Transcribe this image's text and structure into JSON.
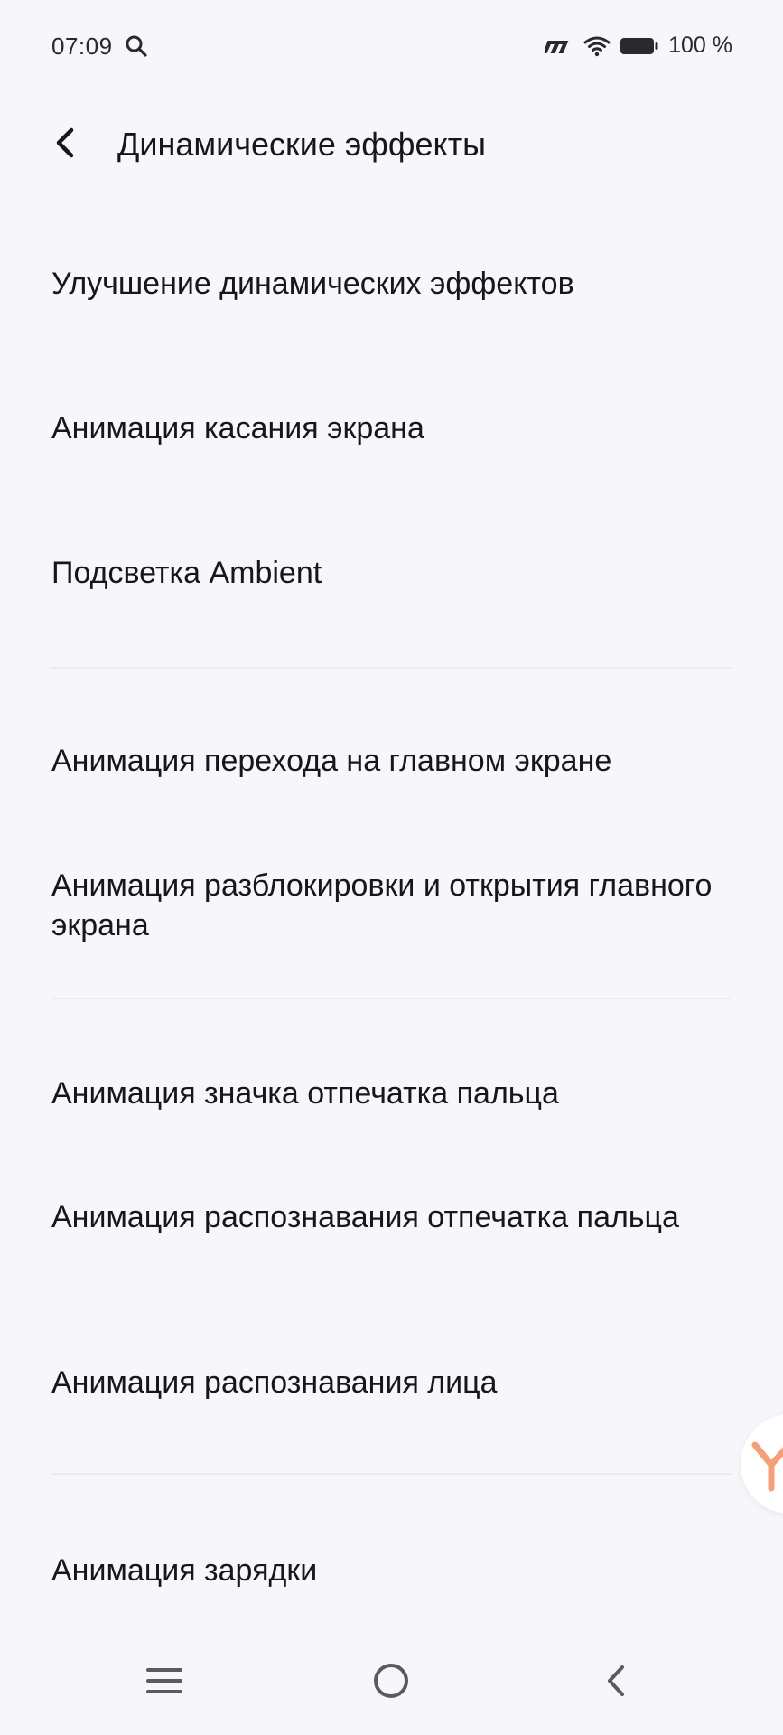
{
  "status_bar": {
    "time": "07:09",
    "battery_text": "100 %"
  },
  "header": {
    "title": "Динамические эффекты"
  },
  "items": [
    {
      "label": "Улучшение динамических эффектов"
    },
    {
      "label": "Анимация касания экрана"
    },
    {
      "label": "Подсветка Ambient"
    },
    {
      "label": "Анимация перехода на главном экране"
    },
    {
      "label": "Анимация разблокировки и открытия главного экрана"
    },
    {
      "label": "Анимация значка отпечатка пальца"
    },
    {
      "label": "Анимация распознавания отпечатка пальца"
    },
    {
      "label": "Анимация распознавания лица"
    },
    {
      "label": "Анимация зарядки"
    }
  ],
  "icons": {
    "status_search": "search-icon",
    "status_network": "network-icon",
    "status_wifi": "wifi-icon",
    "status_battery": "battery-icon",
    "back": "back-arrow-icon",
    "nav_menu": "menu-icon",
    "nav_home": "home-icon",
    "nav_back": "back-icon",
    "floating": "floating-ball-icon"
  },
  "colors": {
    "background": "#f7f6fb",
    "text": "#17171b",
    "divider": "#ebeaf0",
    "floating_accent": "#f4a07a"
  }
}
